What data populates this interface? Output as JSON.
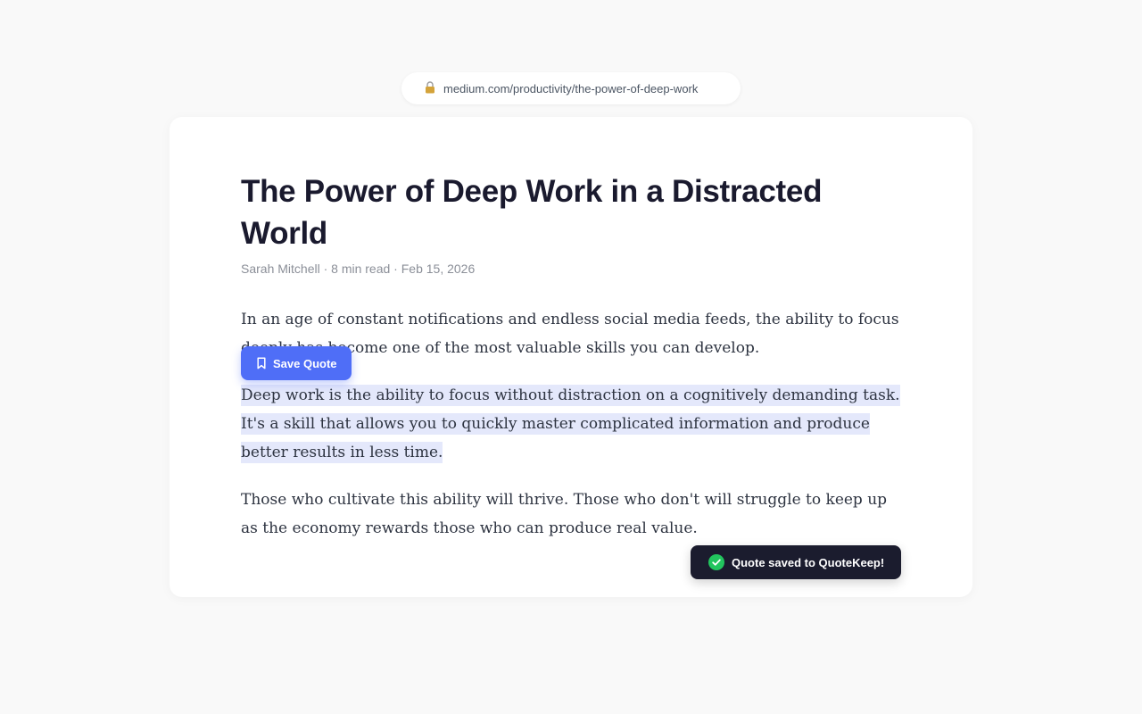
{
  "address_bar": {
    "url": "medium.com/productivity/the-power-of-deep-work",
    "icon": "lock-icon"
  },
  "article": {
    "title": "The Power of Deep Work in a Distracted World",
    "meta": "Sarah Mitchell · 8 min read · Feb 15, 2026",
    "paragraphs": [
      "In an age of constant notifications and endless social media feeds, the ability to focus deeply has become one of the most valuable skills you can develop.",
      "Deep work is the ability to focus without distraction on a cognitively demanding task. It's a skill that allows you to quickly master complicated information and produce better results in less time.",
      "Those who cultivate this ability will thrive. Those who don't will struggle to keep up as the economy rewards those who can produce real value."
    ],
    "highlighted_paragraph_index": 1
  },
  "save_quote_button": {
    "label": "Save Quote",
    "icon": "bookmark-icon",
    "color": "#4f6ef7"
  },
  "toast": {
    "message": "Quote saved to QuoteKeep!",
    "icon": "check-circle-icon",
    "icon_color": "#22c55e",
    "background": "#1b1c2e"
  },
  "colors": {
    "page_background": "#f9f9f9",
    "highlight": "#e4e8fb",
    "title_text": "#1a1a2e"
  }
}
